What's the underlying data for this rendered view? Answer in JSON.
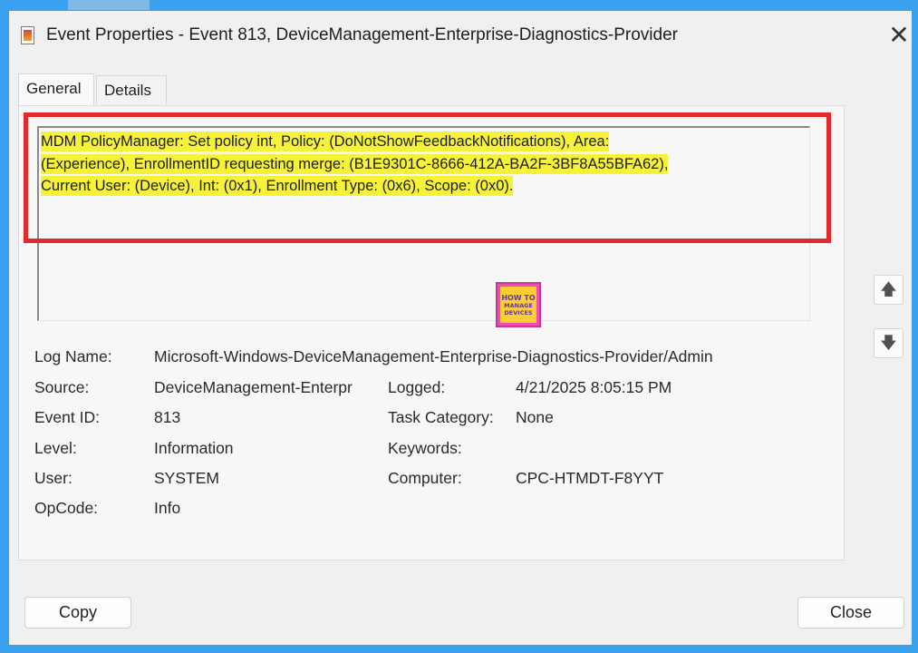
{
  "window": {
    "title": "Event Properties - Event 813, DeviceManagement-Enterprise-Diagnostics-Provider",
    "close_glyph": "✕"
  },
  "tabs": [
    {
      "label": "General",
      "active": true
    },
    {
      "label": "Details",
      "active": false
    }
  ],
  "message": {
    "line1": "MDM PolicyManager: Set policy int, Policy: (DoNotShowFeedbackNotifications), Area:",
    "line2": "(Experience), EnrollmentID requesting merge: (B1E9301C-8666-412A-BA2F-3BF8A55BFA62),",
    "line3": "Current User: (Device), Int: (0x1), Enrollment Type: (0x6), Scope: (0x0).",
    "highlight_color": "#f6f23a",
    "annotation_box_color": "#e32a2a"
  },
  "logo": {
    "line1": "HOW TO",
    "line2": "MANAGE",
    "line3": "DEVICES"
  },
  "fields": {
    "log_name": {
      "label": "Log Name:",
      "value": "Microsoft-Windows-DeviceManagement-Enterprise-Diagnostics-Provider/Admin"
    },
    "source": {
      "label": "Source:",
      "value": "DeviceManagement-Enterpr"
    },
    "logged": {
      "label": "Logged:",
      "value": "4/21/2025 8:05:15 PM"
    },
    "event_id": {
      "label": "Event ID:",
      "value": "813"
    },
    "task_category": {
      "label": "Task Category:",
      "value": "None"
    },
    "level": {
      "label": "Level:",
      "value": "Information"
    },
    "keywords": {
      "label": "Keywords:",
      "value": ""
    },
    "user": {
      "label": "User:",
      "value": "SYSTEM"
    },
    "computer": {
      "label": "Computer:",
      "value": "CPC-HTMDT-F8YYT"
    },
    "opcode": {
      "label": "OpCode:",
      "value": "Info"
    }
  },
  "nav": {
    "up_glyph": "🡅",
    "down_glyph": "🡇"
  },
  "buttons": {
    "copy": "Copy",
    "close": "Close"
  },
  "colors": {
    "background": "#3aa1ef",
    "window": "#f0f0f0"
  }
}
